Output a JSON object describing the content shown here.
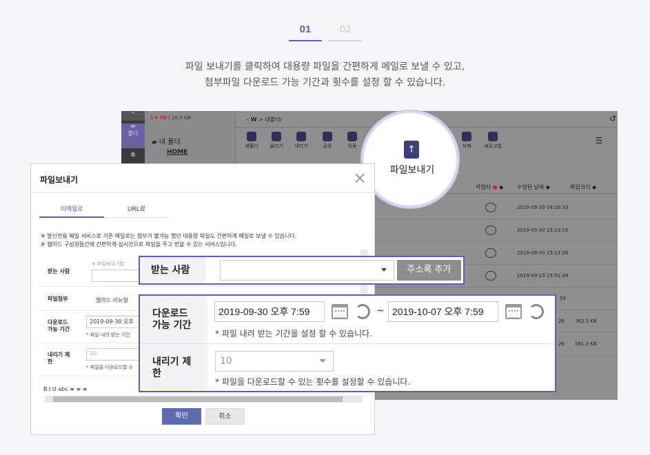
{
  "steps": [
    "01",
    "02"
  ],
  "intro": {
    "line1": "파일 보내기를 클릭하여 대용량 파일을 간편하게 메일로 보낼 수 있고,",
    "line2": "첨부파일 다운로드 가능 기간과 횟수를 설정 할 수 있습니다."
  },
  "app": {
    "storage_used": "5.4 MB",
    "storage_total": "28.5 GB",
    "my_folder": "내 폴더",
    "home": "HOME",
    "leftbar": [
      "폴더",
      "",
      ""
    ],
    "path": "내폴더/",
    "toolbar": [
      "새폴더",
      "올리기",
      "내리기",
      "공유",
      "이동",
      "삭제",
      "새로고침"
    ],
    "columns": {
      "author": "작업자",
      "modified": "수정된 날짜",
      "size": "파일크기"
    },
    "rows": [
      {
        "date": "2019-09-30 14:16:33",
        "size": ""
      },
      {
        "date": "2019-09-30 15:13:16",
        "size": ""
      },
      {
        "date": "2019-09-30 15:13:28",
        "size": ""
      },
      {
        "date": "2019-09-23 15:51:39",
        "size": ""
      },
      {
        "date": "59",
        "size": ""
      },
      {
        "date": "26",
        "size": "762.5 KB"
      },
      {
        "date": "26",
        "size": "581.3 KB"
      }
    ]
  },
  "magnifier": {
    "label": "파일보내기"
  },
  "dialog": {
    "title": "파일보내기",
    "tabs": [
      "이메일로",
      "URL로"
    ],
    "notice1": "※ 발신전용 메일 서비스로 기존 메일로는 첨부가 불가능 했던 대용량 파일도 간편하게 메일로 보낼 수 있습니다.",
    "notice2": "※ 웹하드 구성원들간에 간편하게 실시간으로 파일을 주고 받을 수 있는 서비스입니다.",
    "recipient_label": "받는 사람",
    "recipient_hint": "※ 파일보내기할",
    "attach_label": "파일첨부",
    "attach_value": "웹하드 리뉴얼",
    "download_label1": "다운로드",
    "download_label2": "가능 기간",
    "download_value": "2019-09-30 오후",
    "download_hint": "* 파일 내려 받는 기간",
    "limit_label1": "내리기 제",
    "limit_label2": "한",
    "limit_value": "10",
    "limit_hint": "* 파일을 다운로드할 수",
    "editor_tools": "B  I  U  abc  ≡  ≡  ≡",
    "ok": "확인",
    "cancel": "취소"
  },
  "zoom_recipient": {
    "label": "받는 사람",
    "add_button": "주소록 추가"
  },
  "zoom_download": {
    "label1": "다운로드",
    "label2": "가능 기간",
    "start": "2019-09-30 오후 7:59",
    "end": "2019-10-07 오후 7:59",
    "separator": "~",
    "hint": "* 파일 내려 받는 기간을 설정 할 수 있습니다.",
    "limit_label1": "내리기 제",
    "limit_label2": "한",
    "limit_value": "10",
    "limit_hint": "* 파일을 다운로드할 수 있는 횟수를 설정할 수 있습니다."
  }
}
